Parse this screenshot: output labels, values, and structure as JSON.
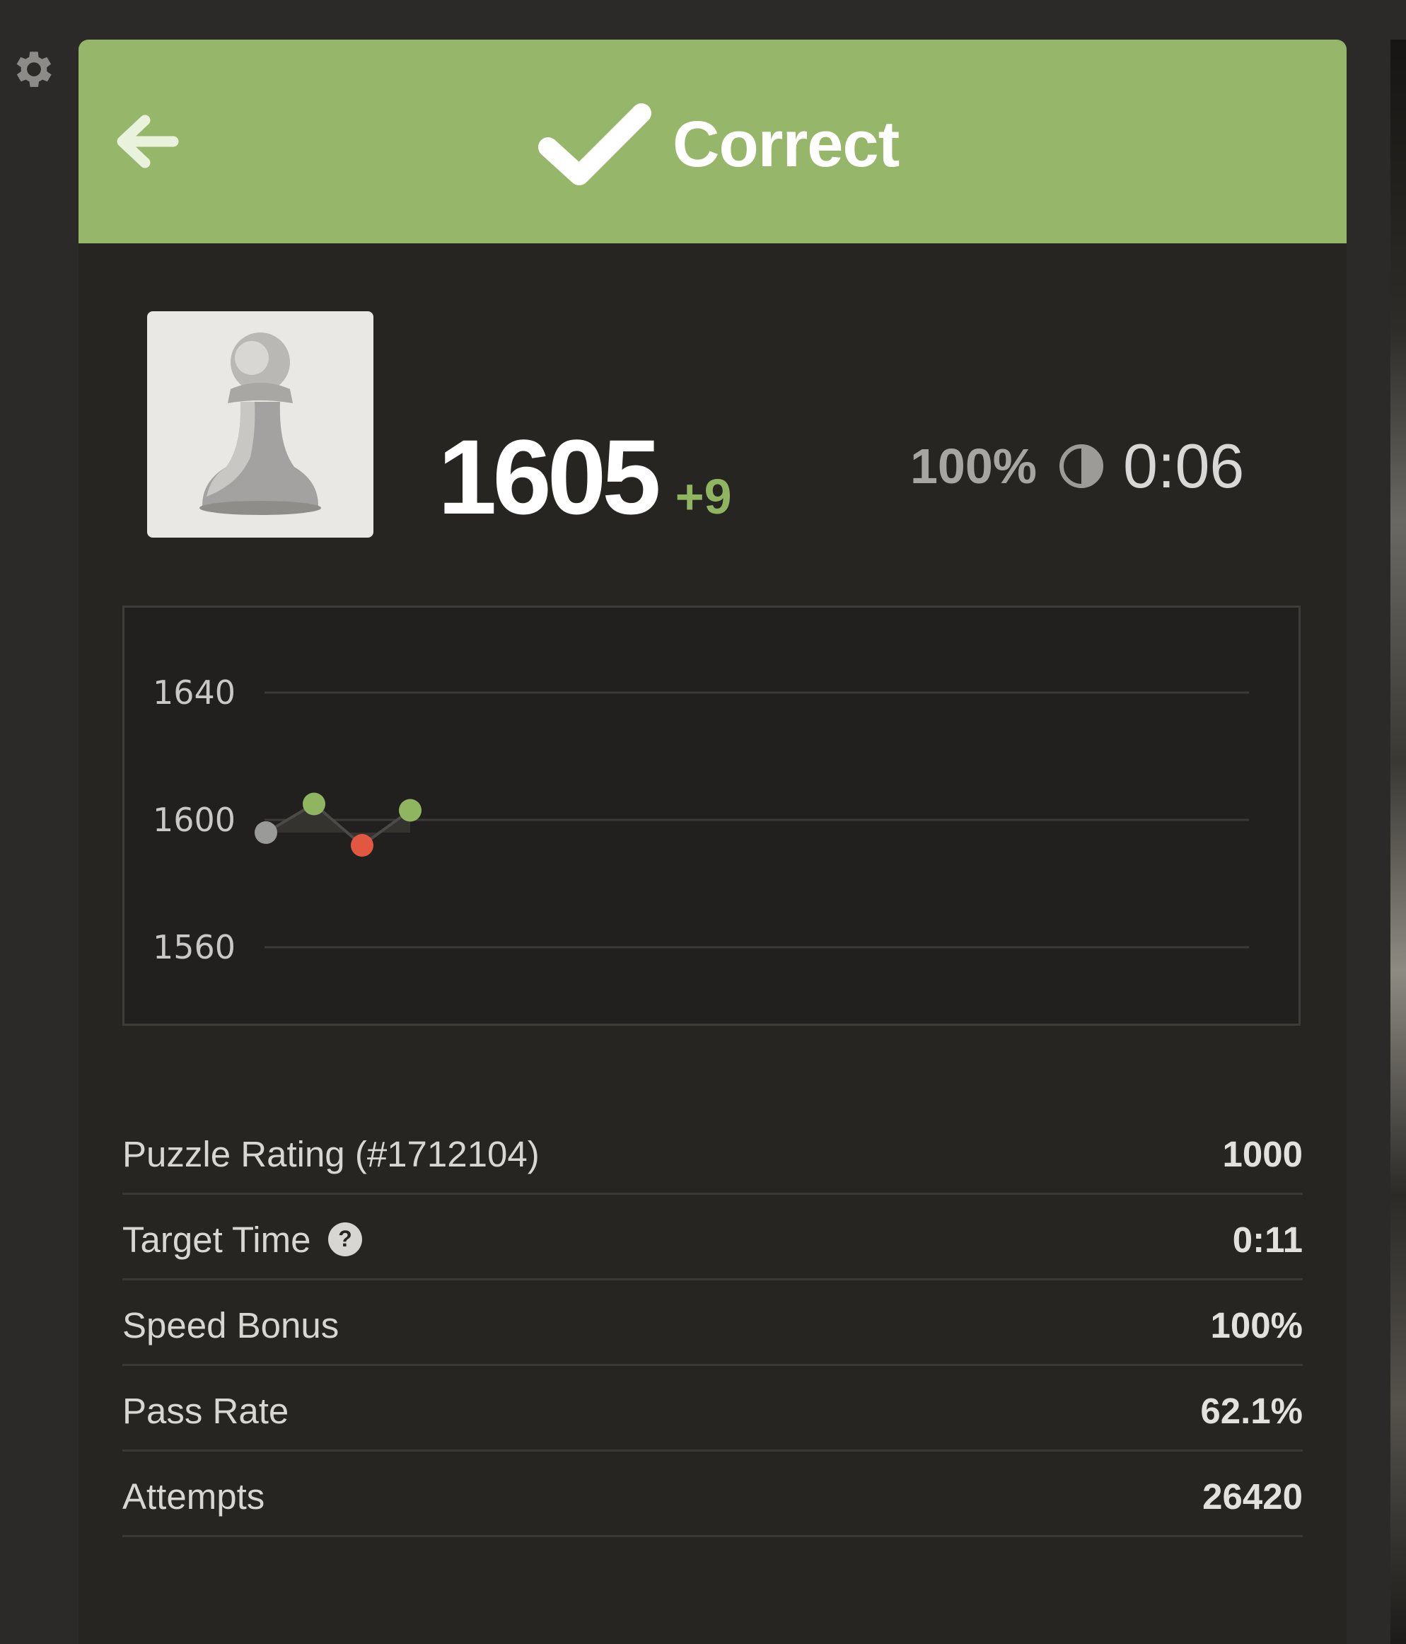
{
  "header": {
    "title": "Correct",
    "back_icon": "arrow-left-icon",
    "check_icon": "checkmark-icon",
    "background": "#96b66a"
  },
  "settings": {
    "icon": "gear-icon"
  },
  "player": {
    "avatar_icon": "pawn-icon",
    "rating": "1605",
    "rating_delta": "+9",
    "speed_percent": "100%",
    "speed_icon": "half-circle-icon",
    "time": "0:06"
  },
  "chart_data": {
    "type": "line",
    "title": "",
    "xlabel": "",
    "ylabel": "",
    "ylim": [
      1560,
      1640
    ],
    "y_ticks": [
      "1640",
      "1600",
      "1560"
    ],
    "grid": true,
    "x": [
      1,
      2,
      3,
      4
    ],
    "values": [
      1596,
      1605,
      1592,
      1603
    ],
    "point_status": [
      "start",
      "win",
      "loss",
      "win"
    ],
    "colors": {
      "start": "#9a9a98",
      "win": "#8fb560",
      "loss": "#e15741",
      "line": "#4a4a47"
    }
  },
  "details": [
    {
      "label": "Puzzle Rating (#1712104)",
      "value": "1000",
      "help": false
    },
    {
      "label": "Target Time",
      "value": "0:11",
      "help": true
    },
    {
      "label": "Speed Bonus",
      "value": "100%",
      "help": false
    },
    {
      "label": "Pass Rate",
      "value": "62.1%",
      "help": false
    },
    {
      "label": "Attempts",
      "value": "26420",
      "help": false
    }
  ]
}
